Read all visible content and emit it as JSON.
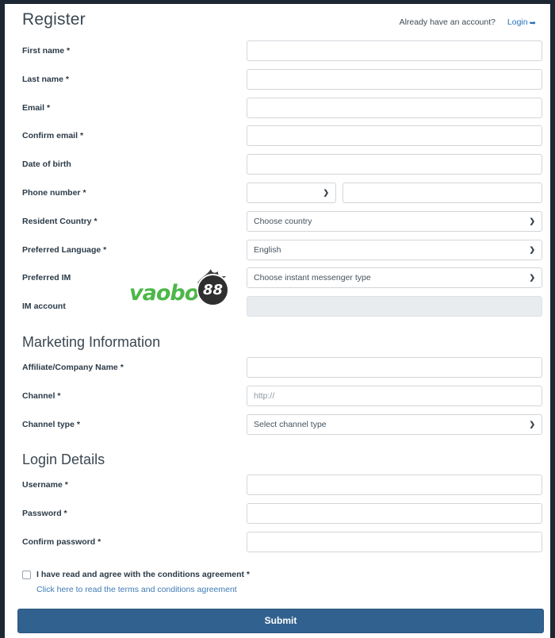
{
  "header": {
    "title": "Register",
    "account_hint": "Already have an account?",
    "login_label": "Login",
    "login_icon": "signin-arrow-icon"
  },
  "personal_fields": [
    {
      "label": "First name",
      "required": "*",
      "type": "text",
      "value": "",
      "placeholder": ""
    },
    {
      "label": "Last name",
      "required": "*",
      "type": "text",
      "value": "",
      "placeholder": ""
    },
    {
      "label": "Email",
      "required": "*",
      "type": "text",
      "value": "",
      "placeholder": ""
    },
    {
      "label": "Confirm email",
      "required": "*",
      "type": "text",
      "value": "",
      "placeholder": ""
    },
    {
      "label": "Date of birth",
      "required": "",
      "type": "text",
      "value": "",
      "placeholder": ""
    }
  ],
  "phone_row": {
    "label": "Phone number",
    "required": "*",
    "code_value": "",
    "number_value": "",
    "number_placeholder": ""
  },
  "select_fields": [
    {
      "label": "Resident Country",
      "required": "*",
      "selected": "Choose country"
    },
    {
      "label": "Preferred Language",
      "required": "*",
      "selected": "English"
    },
    {
      "label": "Preferred IM",
      "required": "",
      "selected": "Choose instant messenger type"
    }
  ],
  "im_account": {
    "label": "IM account",
    "required": "",
    "value": "",
    "placeholder": "",
    "disabled": true
  },
  "marketing": {
    "heading": "Marketing Information",
    "fields": [
      {
        "label": "Affiliate/Company Name",
        "required": "*",
        "kind": "text",
        "value": "",
        "placeholder": ""
      },
      {
        "label": "Channel",
        "required": "*",
        "kind": "text",
        "value": "",
        "placeholder": "http://"
      }
    ],
    "channel_type": {
      "label": "Channel type",
      "required": "*",
      "selected": "Select channel type"
    }
  },
  "login_details": {
    "heading": "Login Details",
    "fields": [
      {
        "label": "Username",
        "required": "*",
        "value": "",
        "placeholder": ""
      },
      {
        "label": "Password",
        "required": "*",
        "value": "",
        "placeholder": ""
      },
      {
        "label": "Confirm password",
        "required": "*",
        "value": "",
        "placeholder": ""
      }
    ]
  },
  "terms": {
    "checkbox_label": "I have read and agree with the conditions agreement *",
    "link_label": "Click here to read the terms and conditions agreement",
    "checked": false
  },
  "submit": {
    "label": "Submit"
  },
  "watermark": {
    "text": "vaobo",
    "badge": "88"
  },
  "colors": {
    "accent_blue": "#2a6ebb",
    "submit_blue": "#31618f",
    "link_blue": "#3f7bb6",
    "label_dark": "#2b3a47",
    "heading": "#3a4751",
    "frame": "#1c2733",
    "watermark_green": "#4cb748",
    "disabled_bg": "#e9ecef"
  }
}
